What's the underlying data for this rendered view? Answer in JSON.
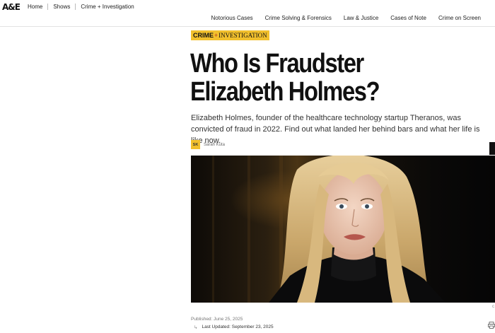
{
  "site": {
    "logo": "A&E",
    "nav": [
      "Home",
      "Shows",
      "Crime + Investigation"
    ]
  },
  "subnav": [
    "Notorious Cases",
    "Crime Solving & Forensics",
    "Law & Justice",
    "Cases of Note",
    "Crime on Screen"
  ],
  "article": {
    "tag_left": "CRIME",
    "tag_plus": "+",
    "tag_right": "INVESTIGATION",
    "headline": "Who Is Fraudster Elizabeth Holmes?",
    "dek": "Elizabeth Holmes, founder of the healthcare technology startup Theranos, was convicted of fraud in 2022. Find out what landed her behind bars and what her life is like now.",
    "author_initials": "SK",
    "author": "Sarah Kuta",
    "published": "Published: June 25, 2025",
    "updated": "Last Updated: September 23, 2025",
    "caption_mark": "c"
  },
  "colors": {
    "accent": "#f2c02d",
    "plus_red": "#b5341f"
  }
}
